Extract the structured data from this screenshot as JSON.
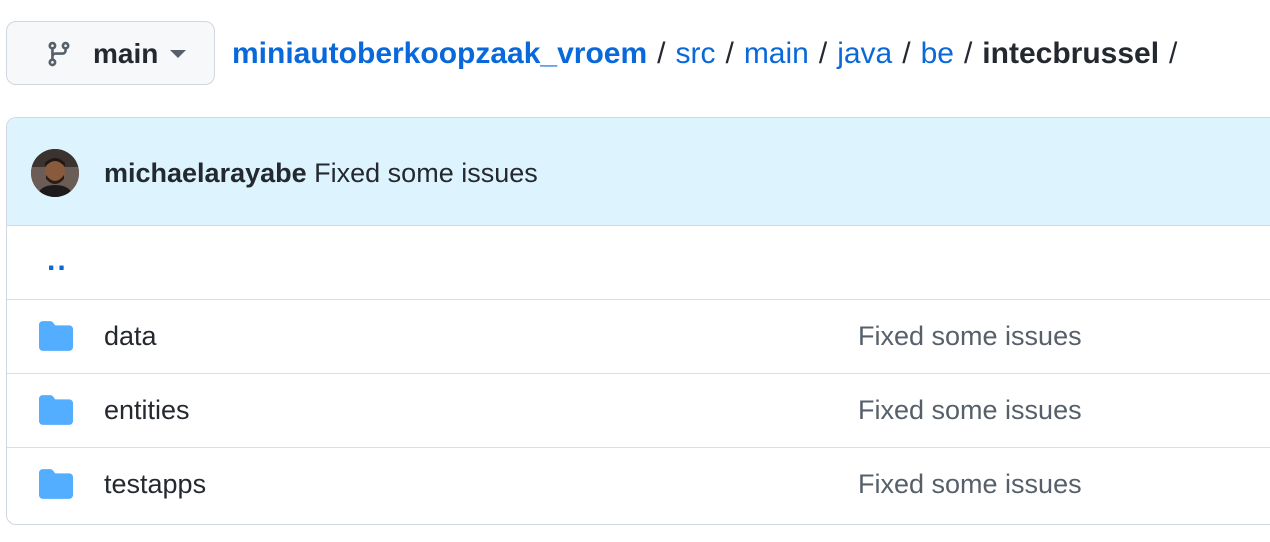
{
  "branch": {
    "label": "main",
    "icon": "git-branch-icon"
  },
  "breadcrumb": {
    "repo": "miniautoberkoopzaak_vroem",
    "segments": [
      "src",
      "main",
      "java",
      "be"
    ],
    "current": "intecbrussel",
    "separator": "/"
  },
  "commit": {
    "author": "michaelarayabe",
    "message": "Fixed some issues"
  },
  "parent_dir": "..",
  "files": [
    {
      "name": "data",
      "type": "folder",
      "icon": "folder-icon",
      "last_commit": "Fixed some issues"
    },
    {
      "name": "entities",
      "type": "folder",
      "icon": "folder-icon",
      "last_commit": "Fixed some issues"
    },
    {
      "name": "testapps",
      "type": "folder",
      "icon": "folder-icon",
      "last_commit": "Fixed some issues"
    }
  ],
  "colors": {
    "link": "#0969da",
    "header_bg": "#ddf4ff",
    "folder": "#54aeff"
  }
}
